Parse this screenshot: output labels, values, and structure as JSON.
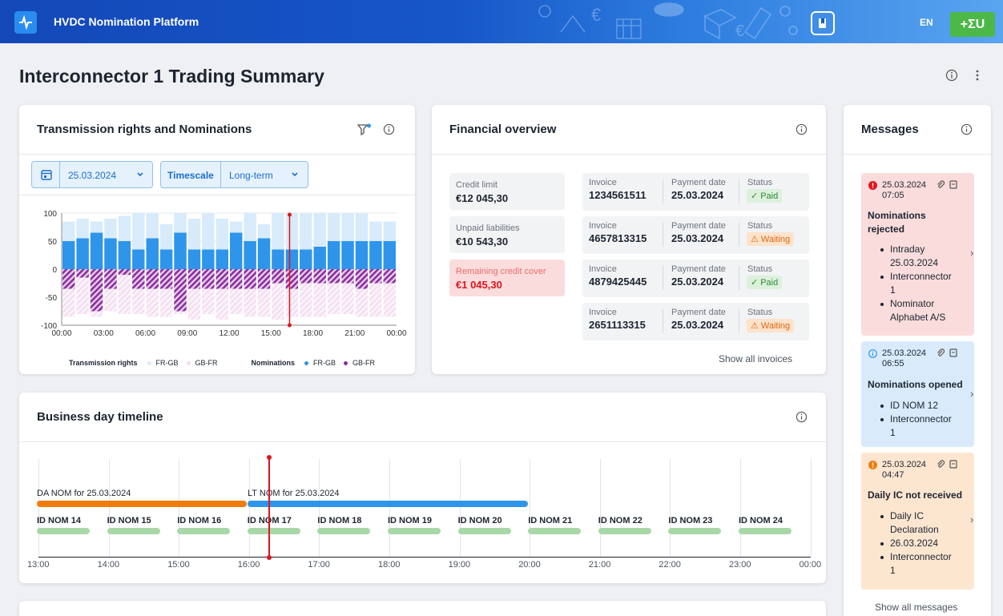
{
  "app": {
    "title": "HVDC Nomination Platform",
    "language": "EN",
    "brand_label": "+ΣU"
  },
  "page": {
    "title": "Interconnector 1 Trading Summary"
  },
  "transmission": {
    "title": "Transmission rights and Nominations",
    "date": "25.03.2024",
    "timescale_label": "Timescale",
    "timescale_value": "Long-term",
    "legend": {
      "tr_title": "Transmission rights",
      "tr_fr_gb": "FR-GB",
      "tr_gb_fr": "GB-FR",
      "nom_title": "Nominations",
      "nom_fr_gb": "FR-GB",
      "nom_gb_fr": "GB-FR"
    },
    "colors": {
      "tr_fr_gb": "#d7ebfb",
      "tr_gb_fr": "#f3dcef",
      "nom_fr_gb": "#2e95ea",
      "nom_gb_fr": "#8b2fa0"
    }
  },
  "chart_data": {
    "type": "bar",
    "x": [
      "00:00",
      "01:00",
      "02:00",
      "03:00",
      "04:00",
      "05:00",
      "06:00",
      "07:00",
      "08:00",
      "09:00",
      "10:00",
      "11:00",
      "12:00",
      "13:00",
      "14:00",
      "15:00",
      "16:00",
      "17:00",
      "18:00",
      "19:00",
      "20:00",
      "21:00",
      "22:00",
      "23:00"
    ],
    "x_ticks": [
      "00:00",
      "03:00",
      "06:00",
      "09:00",
      "12:00",
      "15:00",
      "18:00",
      "21:00",
      "00:00"
    ],
    "y_ticks": [
      100,
      50,
      0,
      -50,
      -100
    ],
    "ylim": [
      -100,
      100
    ],
    "current_time": "16:20",
    "series": [
      {
        "name": "Transmission rights FR-GB",
        "values": [
          85,
          90,
          85,
          90,
          95,
          100,
          100,
          80,
          100,
          90,
          100,
          90,
          85,
          100,
          80,
          100,
          100,
          100,
          100,
          100,
          100,
          100,
          85,
          85
        ]
      },
      {
        "name": "Transmission rights GB-FR",
        "values": [
          -85,
          -80,
          -85,
          -75,
          -80,
          -80,
          -85,
          -85,
          -80,
          -90,
          -80,
          -90,
          -80,
          -85,
          -85,
          -90,
          -85,
          -85,
          -85,
          -80,
          -80,
          -85,
          -85,
          -85
        ]
      },
      {
        "name": "Nominations FR-GB",
        "values": [
          50,
          55,
          65,
          55,
          50,
          35,
          55,
          35,
          65,
          35,
          35,
          35,
          65,
          50,
          55,
          35,
          35,
          35,
          40,
          50,
          50,
          50,
          50,
          50
        ]
      },
      {
        "name": "Nominations GB-FR",
        "values": [
          -35,
          -15,
          -75,
          -35,
          -10,
          -35,
          -35,
          -35,
          -75,
          -35,
          -35,
          -35,
          -35,
          -35,
          -35,
          -25,
          -35,
          -25,
          -25,
          -25,
          -25,
          -35,
          -25,
          -25
        ]
      }
    ]
  },
  "financial": {
    "title": "Financial overview",
    "summary": [
      {
        "label": "Credit limit",
        "value": "€12 045,30"
      },
      {
        "label": "Unpaid liabilities",
        "value": "€10 543,30"
      },
      {
        "label": "Remaining credit cover",
        "value": "€1 045,30"
      }
    ],
    "invoice_label": "Invoice",
    "payment_label": "Payment date",
    "status_label": "Status",
    "invoices": [
      {
        "number": "1234561511",
        "date": "25.03.2024",
        "status": "Paid"
      },
      {
        "number": "4657813315",
        "date": "25.03.2024",
        "status": "Waiting"
      },
      {
        "number": "4879425445",
        "date": "25.03.2024",
        "status": "Paid"
      },
      {
        "number": "2651113315",
        "date": "25.03.2024",
        "status": "Waiting"
      }
    ],
    "show_all": "Show all invoices"
  },
  "timeline": {
    "title": "Business day timeline",
    "da_label": "DA NOM for 25.03.2024",
    "lt_label": "LT NOM for 25.03.2024",
    "ids": [
      "ID NOM 14",
      "ID NOM 15",
      "ID NOM 16",
      "ID NOM 17",
      "ID NOM 18",
      "ID NOM 19",
      "ID NOM 20",
      "ID NOM 21",
      "ID NOM 22",
      "ID NOM 23",
      "ID NOM 24"
    ],
    "ticks": [
      "13:00",
      "14:00",
      "15:00",
      "16:00",
      "17:00",
      "18:00",
      "19:00",
      "20:00",
      "21:00",
      "22:00",
      "23:00",
      "00:00"
    ],
    "colors": {
      "da": "#f07c10",
      "lt": "#2e95ea",
      "id": "#a8d8a8",
      "now": "#e0141e"
    }
  },
  "messages": {
    "title": "Messages",
    "items": [
      {
        "date": "25.03.2024",
        "time": "07:05",
        "title_1": "Nominations",
        "title_2": "rejected",
        "lines": [
          "Intraday",
          "25.03.2024",
          "Interconnector",
          "1",
          "Nominator",
          "Alphabet A/S"
        ],
        "color": "#fadcdc",
        "accent": "#e0141e"
      },
      {
        "date": "25.03.2024",
        "time": "06:55",
        "title_1": "Nominations opened",
        "lines": [
          "ID NOM 12",
          "Interconnector",
          "1"
        ],
        "color": "#d9ebfb",
        "accent": "#2e95ea"
      },
      {
        "date": "25.03.2024",
        "time": "04:47",
        "title_1": "Daily IC not received",
        "lines": [
          "Daily IC",
          "Declaration",
          "26.03.2024",
          "Interconnector",
          "1"
        ],
        "color": "#fde6d0",
        "accent": "#f07c10"
      }
    ],
    "show_all": "Show all messages"
  }
}
